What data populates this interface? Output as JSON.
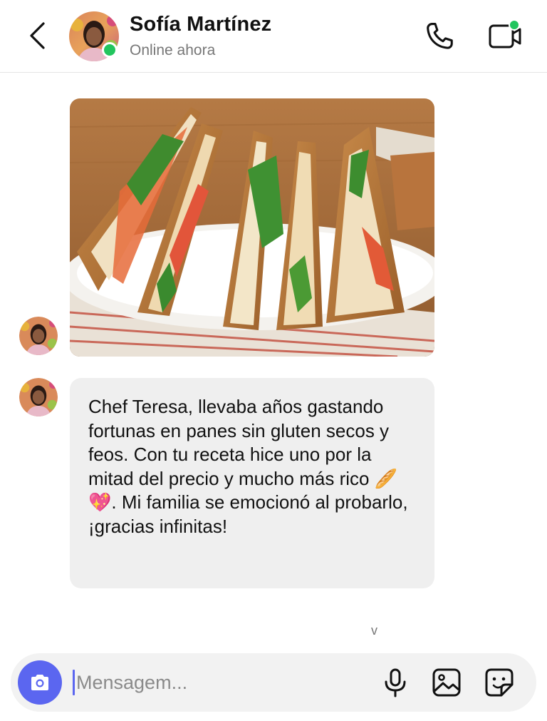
{
  "header": {
    "contact_name": "Sofía Martínez",
    "status": "Online ahora",
    "back_icon": "chevron-left-icon",
    "call_icon": "phone-icon",
    "video_icon": "video-camera-icon",
    "online_color": "#22c55e"
  },
  "messages": [
    {
      "type": "image",
      "sender": "Sofía Martínez",
      "image_subject": "club sandwich photo"
    },
    {
      "type": "text",
      "sender": "Sofía Martínez",
      "text": "Chef Teresa, llevaba años gastando fortunas en panes sin gluten secos y feos. Con tu receta hice uno por la mitad del precio y mucho más rico 🥖💖. Mi familia se emocionó al probarlo, ¡gracias infinitas!"
    }
  ],
  "scroll_hint": "v",
  "composer": {
    "placeholder": "Mensagem...",
    "value": "",
    "accent_color": "#5b66f0",
    "icons": [
      "camera-icon",
      "microphone-icon",
      "image-icon",
      "sticker-icon"
    ]
  }
}
